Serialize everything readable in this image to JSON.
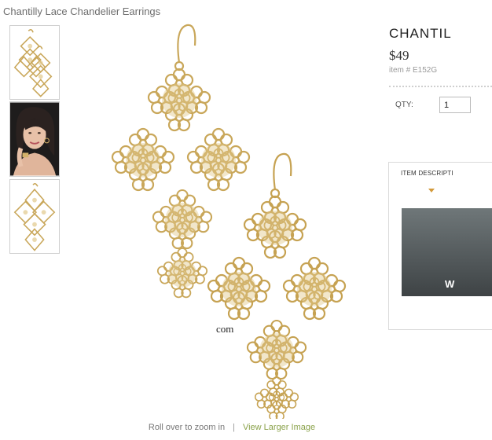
{
  "product": {
    "breadcrumb_title": "Chantilly Lace Chandelier Earrings",
    "name_truncated": "CHANTIL",
    "price": "$49",
    "item_number": "item # E152G",
    "qty_label": "QTY:",
    "qty_value": "1"
  },
  "gallery": {
    "thumbnails": [
      "earrings-thumbnail",
      "model-photo-thumbnail",
      "single-earring-thumbnail"
    ],
    "watermark_text": "com",
    "zoom_hint": "Roll over to zoom in",
    "separator": "|",
    "larger_image_link": "View Larger Image"
  },
  "details": {
    "tab_label": "ITEM DESCRIPTI",
    "video_caption_partial": "W"
  },
  "colors": {
    "gold": "#c9a75a",
    "link": "#8aa24a",
    "tab_arrow": "#d39a3b"
  }
}
